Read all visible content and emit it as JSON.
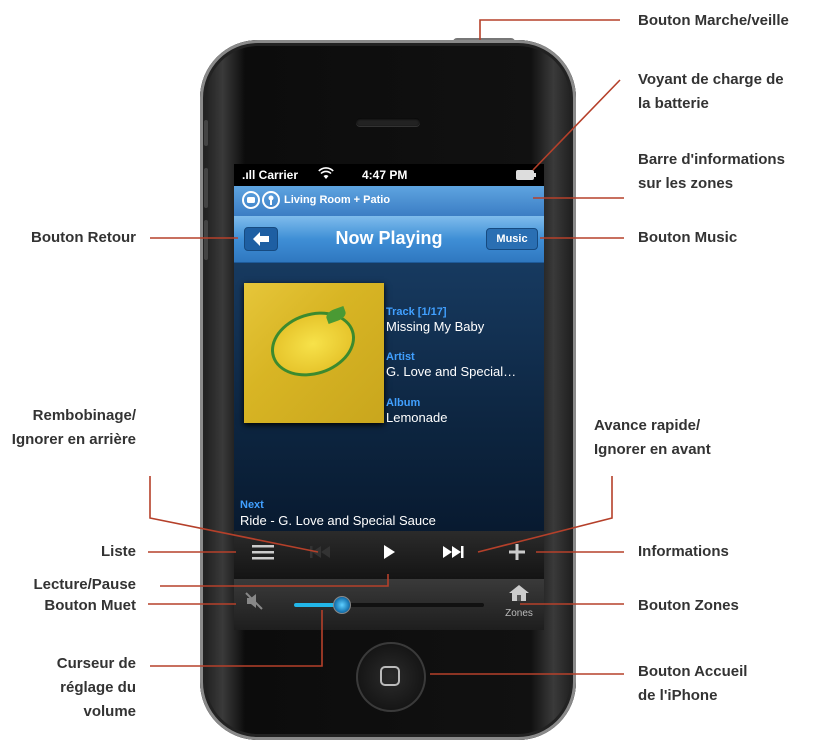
{
  "callouts": {
    "power": "Bouton Marche/veille",
    "battery_line1": "Voyant de charge de",
    "battery_line2": "la batterie",
    "zonebar_line1": "Barre d'informations",
    "zonebar_line2": "sur les zones",
    "music": "Bouton Music",
    "back": "Bouton Retour",
    "rewind_line1": "Rembobinage/",
    "rewind_line2": "Ignorer en arrière",
    "forward_line1": "Avance rapide/",
    "forward_line2": "Ignorer en avant",
    "list": "Liste",
    "info": "Informations",
    "play": "Lecture/Pause",
    "mute": "Bouton Muet",
    "zones": "Bouton Zones",
    "volume_line1": "Curseur de",
    "volume_line2": "réglage du",
    "volume_line3": "volume",
    "home_line1": "Bouton Accueil",
    "home_line2": "de l'iPhone"
  },
  "colors": {
    "callout_line": "#b5402a",
    "accent_blue": "#41a0ff",
    "navbar_blue": "#3f8fd6",
    "volume_fill": "#22b6e8"
  },
  "statusbar": {
    "carrier": ".ıll Carrier",
    "wifi_icon": "wifi-icon",
    "time": "4:47 PM"
  },
  "zonebar": {
    "zone_name": "Living Room + Patio",
    "icon1": "zone-icon",
    "icon2": "group-icon"
  },
  "navbar": {
    "title": "Now Playing",
    "back_icon": "arrow-left-icon",
    "music_label": "Music"
  },
  "track": {
    "track_label": "Track [1/17]",
    "track_value": "Missing My Baby",
    "artist_label": "Artist",
    "artist_value": "G. Love and Special…",
    "album_label": "Album",
    "album_value": "Lemonade",
    "next_label": "Next",
    "next_value": "Ride - G. Love and Special Sauce"
  },
  "controls": {
    "list_icon": "list-icon",
    "rewind_icon": "rewind-icon",
    "play_icon": "play-icon",
    "forward_icon": "fast-forward-icon",
    "info_icon": "plus-icon"
  },
  "volume": {
    "level": 0.25,
    "mute_icon": "speaker-muted-icon",
    "zones_label": "Zones",
    "zones_icon": "house-icon"
  }
}
